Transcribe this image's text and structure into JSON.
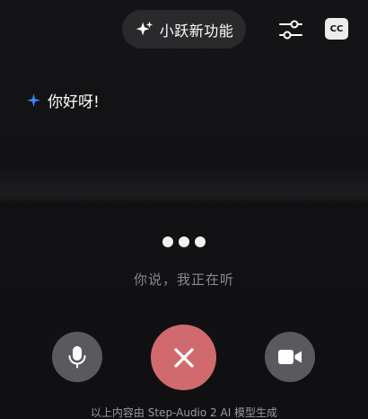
{
  "header": {
    "feature_button_label": "小跃新功能",
    "feature_icon": "sparkle-icon",
    "settings_icon": "sliders-icon",
    "captions_label": "CC"
  },
  "conversation": {
    "assistant_icon": "star-icon",
    "assistant_message": "你好呀!",
    "status_text": "你说，我正在听"
  },
  "controls": {
    "mic_icon": "microphone-icon",
    "hangup_icon": "close-icon",
    "camera_icon": "video-camera-icon",
    "hangup_color": "#d16a6f",
    "secondary_color": "#5a5a5e"
  },
  "footer": {
    "disclaimer": "以上内容由 Step-Audio 2 AI 模型生成"
  }
}
